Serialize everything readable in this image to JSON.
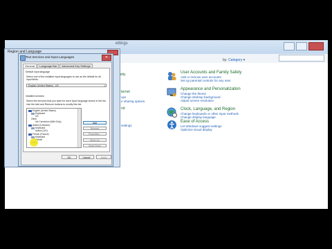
{
  "control_panel": {
    "breadcrumb_tail": "ettings",
    "view_by_label": "by:",
    "view_by_value": "Category",
    "view_by_arrow": "▾",
    "left_fragments": {
      "security": "urity",
      "internet": "ternet",
      "internet_sub": "ups",
      "sharing": "e sharing options",
      "sound": "nd",
      "settings": "settings"
    },
    "categories": [
      {
        "id": "user-accounts",
        "title": "User Accounts and Family Safety",
        "links": [
          "Add or remove user accounts",
          "Set up parental controls for any user"
        ],
        "color": "#3d79c9"
      },
      {
        "id": "appearance",
        "title": "Appearance and Personalization",
        "links": [
          "Change the theme",
          "Change desktop background",
          "Adjust screen resolution"
        ],
        "color": "#6a9bd6"
      },
      {
        "id": "clock",
        "title": "Clock, Language, and Region",
        "links": [
          "Change keyboards or other input methods",
          "Change display language"
        ],
        "color": "#3a9a4a"
      },
      {
        "id": "ease",
        "title": "Ease of Access",
        "links": [
          "Let Windows suggest settings",
          "Optimize visual display"
        ],
        "color": "#2e74c6"
      }
    ]
  },
  "region_window": {
    "title": "Region and Language"
  },
  "dialog": {
    "title": "Text Services and Input Languages",
    "close_glyph": "✕",
    "tabs": [
      "General",
      "Language Bar",
      "Advanced Key Settings"
    ],
    "default_input_label": "Default input language",
    "default_input_desc": "Select one of the installed input languages to use as the default for all input fields.",
    "default_input_value": "English (United States) - US",
    "combo_arrow": "▾",
    "installed_label": "Installed services",
    "installed_desc_1": "Select the services that you want for each input language shown in the list.",
    "installed_desc_2": "Use the Add and Remove buttons to modify this list.",
    "tree": [
      {
        "text": "English (United States)",
        "level": 0,
        "flag": "#3a5fb0"
      },
      {
        "text": "Keyboard",
        "level": 1,
        "flag": ""
      },
      {
        "text": "US",
        "level": 2,
        "flag": ""
      },
      {
        "text": "Other",
        "level": 1,
        "flag": ""
      },
      {
        "text": "Ink Correction (Wiki Only)",
        "level": 2,
        "flag": ""
      },
      {
        "text": "Arabic (Lebanon)",
        "level": 0,
        "flag": "#3a5fb0"
      },
      {
        "text": "Keyboard",
        "level": 1,
        "flag": ""
      },
      {
        "text": "Arabic (101)",
        "level": 2,
        "flag": ""
      },
      {
        "text": "French (France)",
        "level": 0,
        "flag": "#3a5fb0"
      },
      {
        "text": "Keyboard",
        "level": 1,
        "flag": ""
      },
      {
        "text": "French",
        "level": 2,
        "flag": ""
      },
      {
        "text": "Other",
        "level": 1,
        "flag": ""
      }
    ],
    "side_buttons": [
      {
        "label": "Add",
        "enabled": true
      },
      {
        "label": "Remove",
        "enabled": false
      },
      {
        "label": "Properties...",
        "enabled": false
      },
      {
        "label": "Move Up",
        "enabled": false
      },
      {
        "label": "Move Down",
        "enabled": false
      }
    ],
    "bottom_buttons": [
      {
        "label": "OK",
        "enabled": true
      },
      {
        "label": "Cancel",
        "enabled": true
      },
      {
        "label": "Apply",
        "enabled": false
      }
    ]
  }
}
